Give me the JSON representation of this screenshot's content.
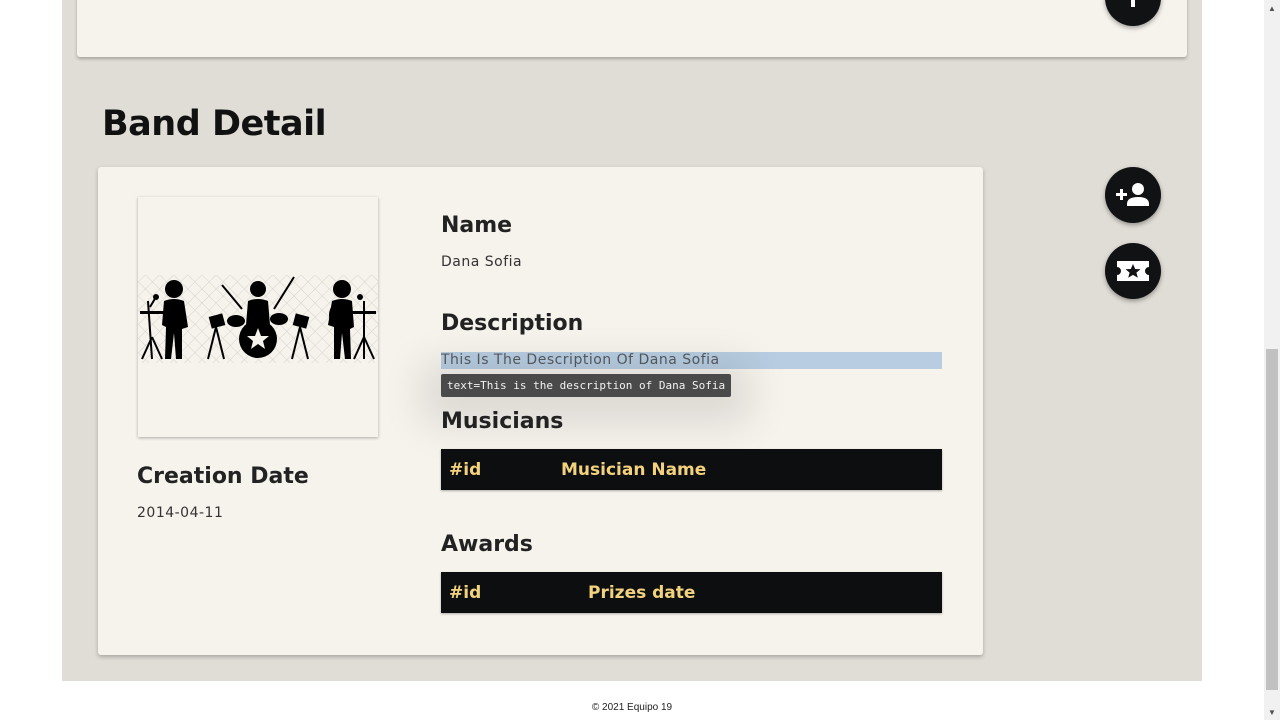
{
  "page": {
    "title": "Band Detail",
    "footer": "© 2021 Equipo 19"
  },
  "band": {
    "creation_date_label": "Creation Date",
    "creation_date": "2014-04-11",
    "name_label": "Name",
    "name": "Dana Sofia",
    "description_label": "Description",
    "description": "This Is The Description Of Dana Sofia",
    "tooltip": "text=This is the description of Dana Sofia",
    "image_icon": "band-illustration"
  },
  "musicians": {
    "label": "Musicians",
    "columns": [
      "#id",
      "Musician Name"
    ],
    "rows": []
  },
  "awards": {
    "label": "Awards",
    "columns": [
      "#id",
      "Prizes date"
    ],
    "rows": []
  },
  "actions": {
    "add_icon": "plus-icon",
    "add_person_icon": "person-add-icon",
    "ticket_icon": "ticket-star-icon"
  },
  "colors": {
    "background": "#e0dcd6",
    "card": "#f6f2ec",
    "fab": "#111214",
    "table_header": "#0d0e10",
    "table_header_text": "#f3d27d",
    "selection": "#b8cde1"
  }
}
